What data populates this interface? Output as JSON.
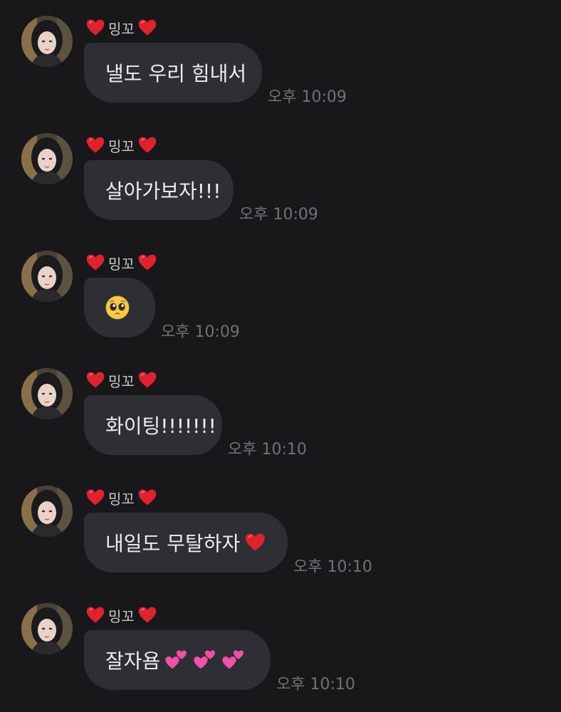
{
  "sender": {
    "name": "밍꼬",
    "left_icon": "red-heart-icon",
    "right_icon": "red-heart-icon"
  },
  "colors": {
    "background": "#18181b",
    "bubble": "#2e2f34",
    "text": "#ededf0",
    "time": "#707078",
    "heart": "#e0212e",
    "sparkle_heart": "#f24fa6"
  },
  "messages": [
    {
      "text": "낼도 우리 힘내서",
      "time": "오후 10:09"
    },
    {
      "text": "살아가보자!!!",
      "time": "오후 10:09"
    },
    {
      "text": "",
      "emoji": "pleading-face-icon",
      "time": "오후 10:09"
    },
    {
      "text": "화이팅!!!!!!!",
      "time": "오후 10:10"
    },
    {
      "text": "내일도 무탈하자",
      "emoji": "red-heart-icon",
      "time": "오후 10:10"
    },
    {
      "text": "잘자욤",
      "emoji": "two-hearts-icon",
      "time": "오후 10:10"
    }
  ]
}
